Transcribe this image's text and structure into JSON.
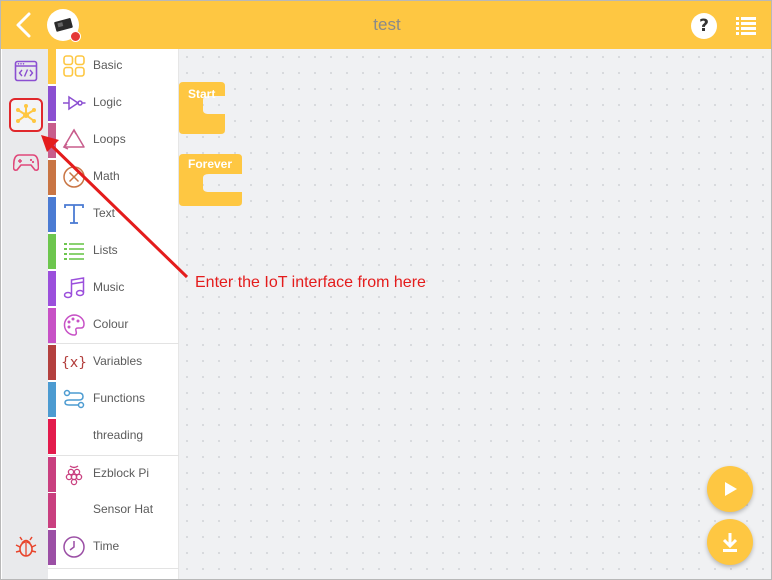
{
  "header": {
    "title": "test",
    "help_label": "?",
    "accent": "#fec742"
  },
  "rail": [
    {
      "name": "code-view-icon",
      "active": false
    },
    {
      "name": "iot-icon",
      "active": true
    },
    {
      "name": "gamepad-icon",
      "active": false
    },
    {
      "name": "bug-icon",
      "active": false
    }
  ],
  "categories": [
    {
      "label": "Basic",
      "color": "#fec742",
      "icon": "grid-icon"
    },
    {
      "label": "Logic",
      "color": "#8b4fd1",
      "icon": "logic-gate-icon"
    },
    {
      "label": "Loops",
      "color": "#c85d8c",
      "icon": "recycle-icon"
    },
    {
      "label": "Math",
      "color": "#c97544",
      "icon": "math-icon"
    },
    {
      "label": "Text",
      "color": "#4b7bd3",
      "icon": "text-icon"
    },
    {
      "label": "Lists",
      "color": "#6dc64e",
      "icon": "list-icon"
    },
    {
      "label": "Music",
      "color": "#9b4fdc",
      "icon": "music-note-icon"
    },
    {
      "label": "Colour",
      "color": "#c751c6",
      "icon": "palette-icon"
    },
    {
      "label": "Variables",
      "color": "#b3403e",
      "icon": "variable-icon"
    },
    {
      "label": "Functions",
      "color": "#4c9bd1",
      "icon": "function-icon"
    },
    {
      "label": "threading",
      "color": "#e31b4c",
      "icon": ""
    },
    {
      "label": "Ezblock Pi",
      "color": "#c93f7f",
      "icon": "raspberry-icon"
    },
    {
      "label": "Sensor Hat",
      "color": "#c93f7f",
      "icon": ""
    },
    {
      "label": "Time",
      "color": "#9b4fa5",
      "icon": "clock-icon"
    }
  ],
  "blocks": {
    "start_label": "Start",
    "forever_label": "Forever",
    "color": "#fec742"
  },
  "annotation": {
    "text": "Enter the IoT interface from here",
    "color": "#e41c1c"
  }
}
